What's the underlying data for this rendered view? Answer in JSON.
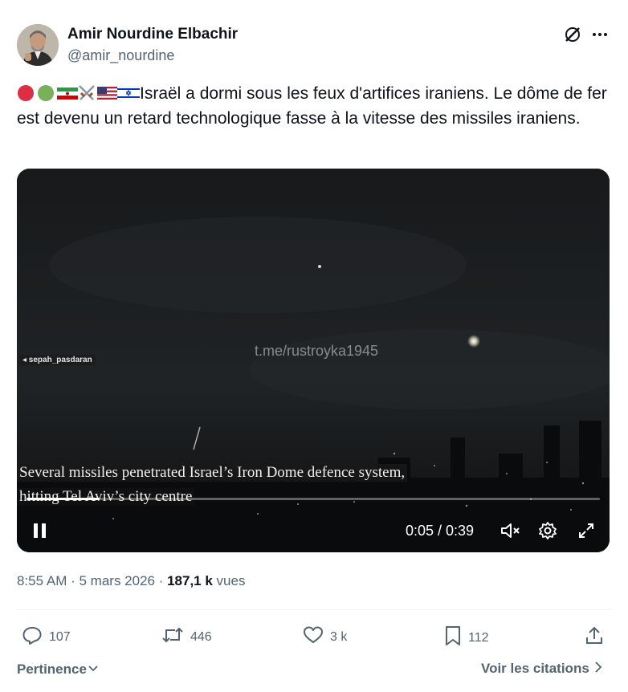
{
  "author": {
    "name": "Amir Nourdine Elbachir",
    "handle": "@amir_nourdine"
  },
  "post": {
    "text": "Israël a dormi sous les feux d'artifices iraniens. Le dôme de fer est devenu un retard technologique fasse à la vitesse des missiles iraniens.",
    "emoji_icons": [
      "red-circle-icon",
      "green-circle-icon",
      "iran-flag-icon",
      "crossed-swords-icon",
      "us-flag-icon",
      "israel-flag-icon"
    ]
  },
  "video": {
    "watermark": "t.me/rustroyka1945",
    "source_tag": "◂ sepah_pasdaran",
    "caption_line1": "Several missiles penetrated Israel’s Iron Dome defence system,",
    "caption_line2": "hitting Tel Aviv’s city centre",
    "time": "0:05 / 0:39",
    "progress": 0.128
  },
  "meta": {
    "time": "8:55 AM",
    "sep1": " · ",
    "date": "5 mars 2026",
    "sep2": " · ",
    "views": "187,1 k",
    "views_label": " vues"
  },
  "actions": {
    "replies": "107",
    "reposts": "446",
    "likes": "3 k",
    "bookmarks": "112"
  },
  "footer": {
    "sort_label": "Pertinence",
    "quotes_link": "Voir les citations"
  }
}
